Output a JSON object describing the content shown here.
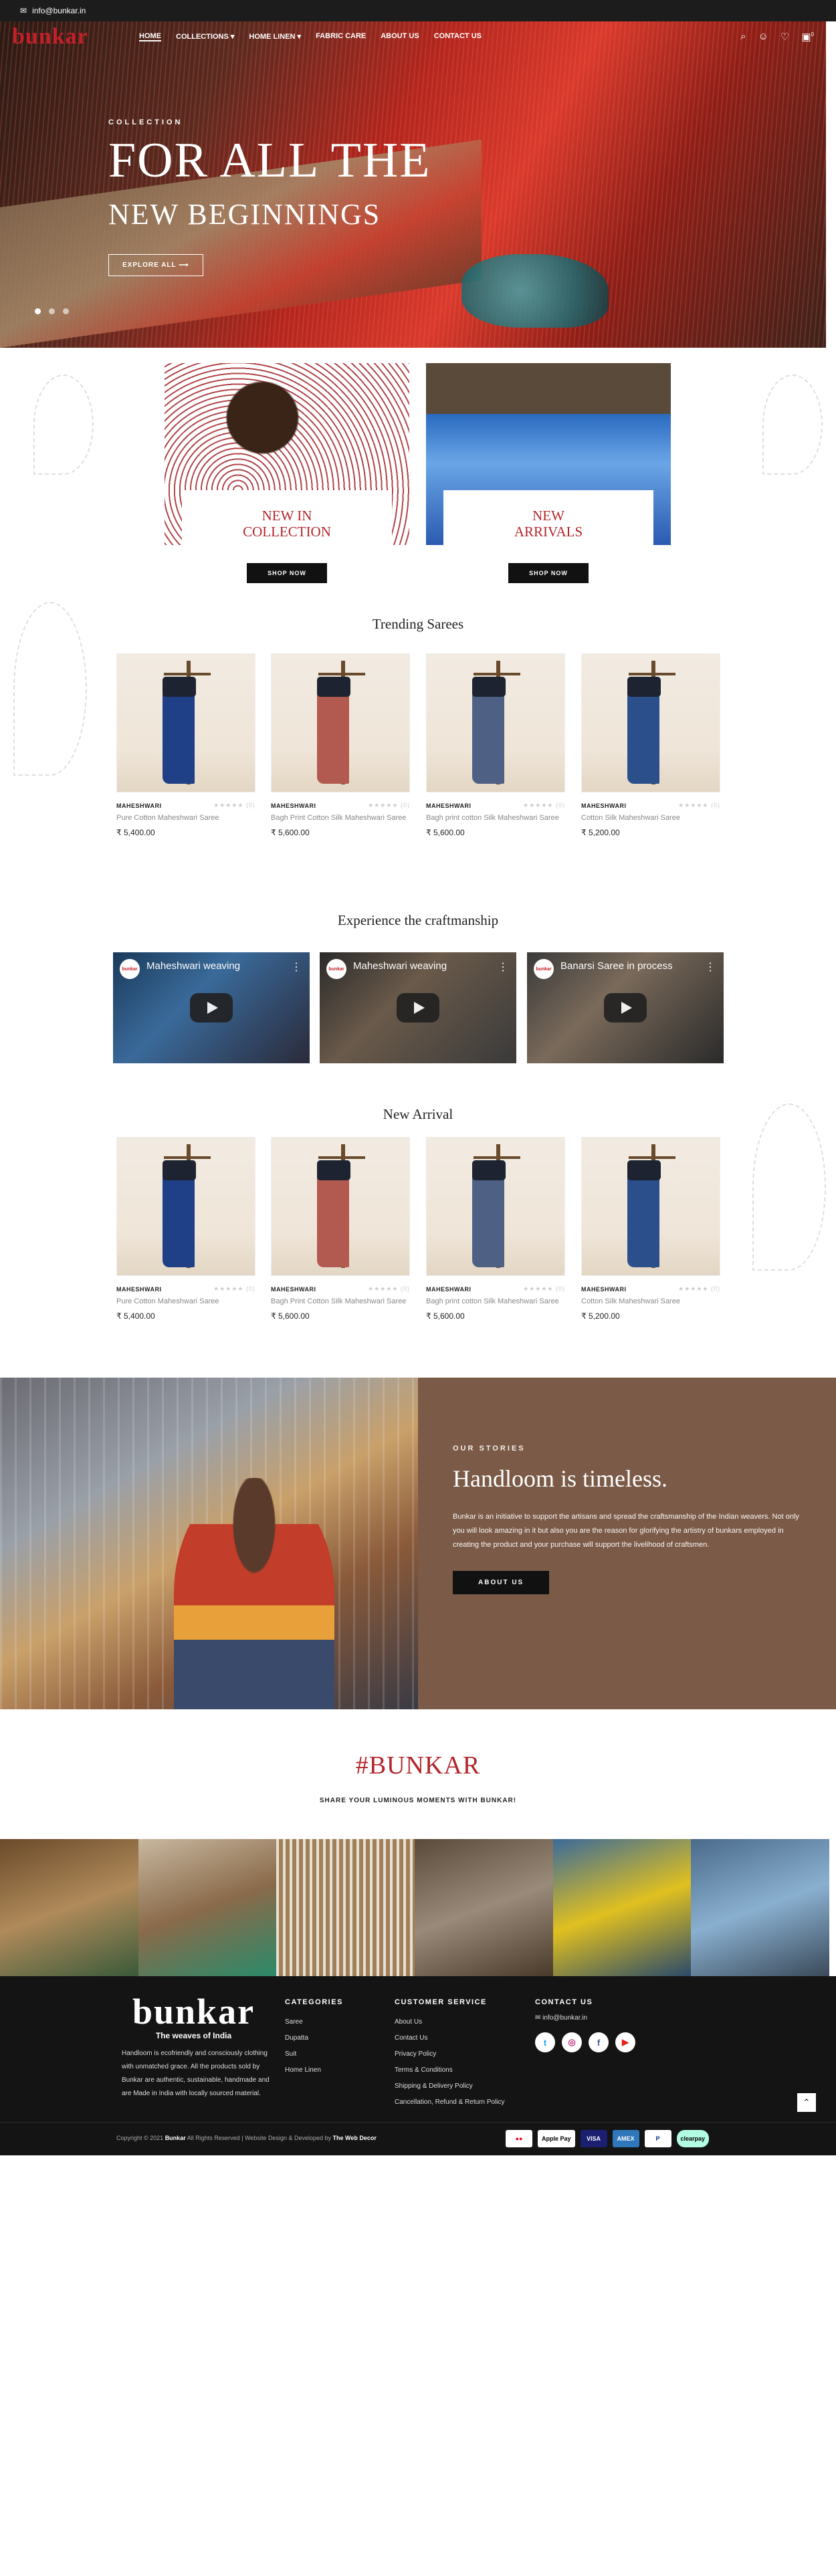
{
  "topbar": {
    "email": "info@bunkar.in",
    "mail_icon": "mail-icon"
  },
  "nav": {
    "logo": "bunkar",
    "items": [
      {
        "label": "HOME",
        "active": true
      },
      {
        "label": "COLLECTIONS ▾"
      },
      {
        "label": "HOME LINEN ▾"
      },
      {
        "label": "FABRIC CARE"
      },
      {
        "label": "ABOUT US"
      },
      {
        "label": "CONTACT US"
      }
    ],
    "icons": [
      "search-icon",
      "user-icon",
      "heart-icon",
      "cart-icon"
    ],
    "cart_count": "0"
  },
  "hero": {
    "label": "COLLECTION",
    "title": "FOR ALL THE",
    "subtitle": "NEW BEGINNINGS",
    "button": "EXPLORE ALL ⟶",
    "slides": 3,
    "active_slide": 1
  },
  "collections": [
    {
      "label_line1": "NEW IN",
      "label_line2": "COLLECTION",
      "button": "SHOP NOW"
    },
    {
      "label_line1": "NEW",
      "label_line2": "ARRIVALS",
      "button": "SHOP NOW"
    }
  ],
  "trending": {
    "title": "Trending Sarees",
    "products": [
      {
        "brand": "MAHESHWARI",
        "reviews": "(0)",
        "name": "Pure Cotton Maheshwari Saree",
        "price": "₹ 5,400.00",
        "color": "#1f3f86"
      },
      {
        "brand": "MAHESHWARI",
        "reviews": "(0)",
        "name": "Bagh Print Cotton Silk Maheshwari Saree",
        "price": "₹ 5,600.00",
        "color": "#b35a50"
      },
      {
        "brand": "MAHESHWARI",
        "reviews": "(0)",
        "name": "Bagh print cotton Silk Maheshwari Saree",
        "price": "₹ 5,600.00",
        "color": "#4e6184"
      },
      {
        "brand": "MAHESHWARI",
        "reviews": "(0)",
        "name": "Cotton Silk Maheshwari Saree",
        "price": "₹ 5,200.00",
        "color": "#2b4f8a"
      }
    ]
  },
  "craft": {
    "title": "Experience the craftmanship",
    "videos": [
      {
        "title": "Maheshwari weaving",
        "channel": "bunkar"
      },
      {
        "title": "Maheshwari weaving",
        "channel": "bunkar"
      },
      {
        "title": "Banarsi Saree in process",
        "channel": "bunkar"
      }
    ]
  },
  "arrivals": {
    "title": "New Arrival",
    "products": [
      {
        "brand": "MAHESHWARI",
        "reviews": "(0)",
        "name": "Pure Cotton Maheshwari Saree",
        "price": "₹ 5,400.00",
        "color": "#1f3f86"
      },
      {
        "brand": "MAHESHWARI",
        "reviews": "(0)",
        "name": "Bagh Print Cotton Silk Maheshwari Saree",
        "price": "₹ 5,600.00",
        "color": "#b35a50"
      },
      {
        "brand": "MAHESHWARI",
        "reviews": "(0)",
        "name": "Bagh print cotton Silk Maheshwari Saree",
        "price": "₹ 5,600.00",
        "color": "#4e6184"
      },
      {
        "brand": "MAHESHWARI",
        "reviews": "(0)",
        "name": "Cotton Silk Maheshwari Saree",
        "price": "₹ 5,200.00",
        "color": "#2b4f8a"
      }
    ]
  },
  "story": {
    "kicker": "OUR STORIES",
    "title": "Handloom is timeless.",
    "text": "Bunkar is an initiative to support the artisans and spread the craftsmanship of the Indian weavers. Not only you will look amazing in it but also you are the reason for glorifying the artistry of bunkars employed in creating the product and your purchase will support the livelihood of craftsmen.",
    "button": "ABOUT US",
    "bg_color": "#7b5a47"
  },
  "social_section": {
    "hashtag": "#BUNKAR",
    "subtitle": "SHARE YOUR LUMINOUS MOMENTS WITH BUNKAR!"
  },
  "footer": {
    "logo": "bunkar",
    "tagline": "The weaves of India",
    "about": "Handloom is ecofriendly and consciously clothing with unmatched grace. All the products sold by Bunkar are authentic, sustainable, handmade and are Made in India with locally sourced material.",
    "categories": {
      "title": "CATEGORIES",
      "items": [
        "Saree",
        "Dupatta",
        "Suit",
        "Home Linen"
      ]
    },
    "service": {
      "title": "CUSTOMER SERVICE",
      "items": [
        "About Us",
        "Contact Us",
        "Privacy Policy",
        "Terms & Conditions",
        "Shipping & Delivery Policy",
        "Cancellation, Refund & Return Policy"
      ]
    },
    "contact": {
      "title": "CONTACT US",
      "email": "info@bunkar.in",
      "social": [
        "twitter-icon",
        "instagram-icon",
        "facebook-icon",
        "youtube-icon"
      ]
    },
    "copyright_prefix": "Copyright © 2021",
    "copyright_brand": "Bunkar",
    "copyright_mid": "All Rights Reserved | Website Design & Developed by",
    "copyright_dev": "The Web Decor",
    "payments": [
      "mastercard",
      "Apple Pay",
      "VISA",
      "AMEX",
      "PayPal",
      "clearpay"
    ]
  }
}
